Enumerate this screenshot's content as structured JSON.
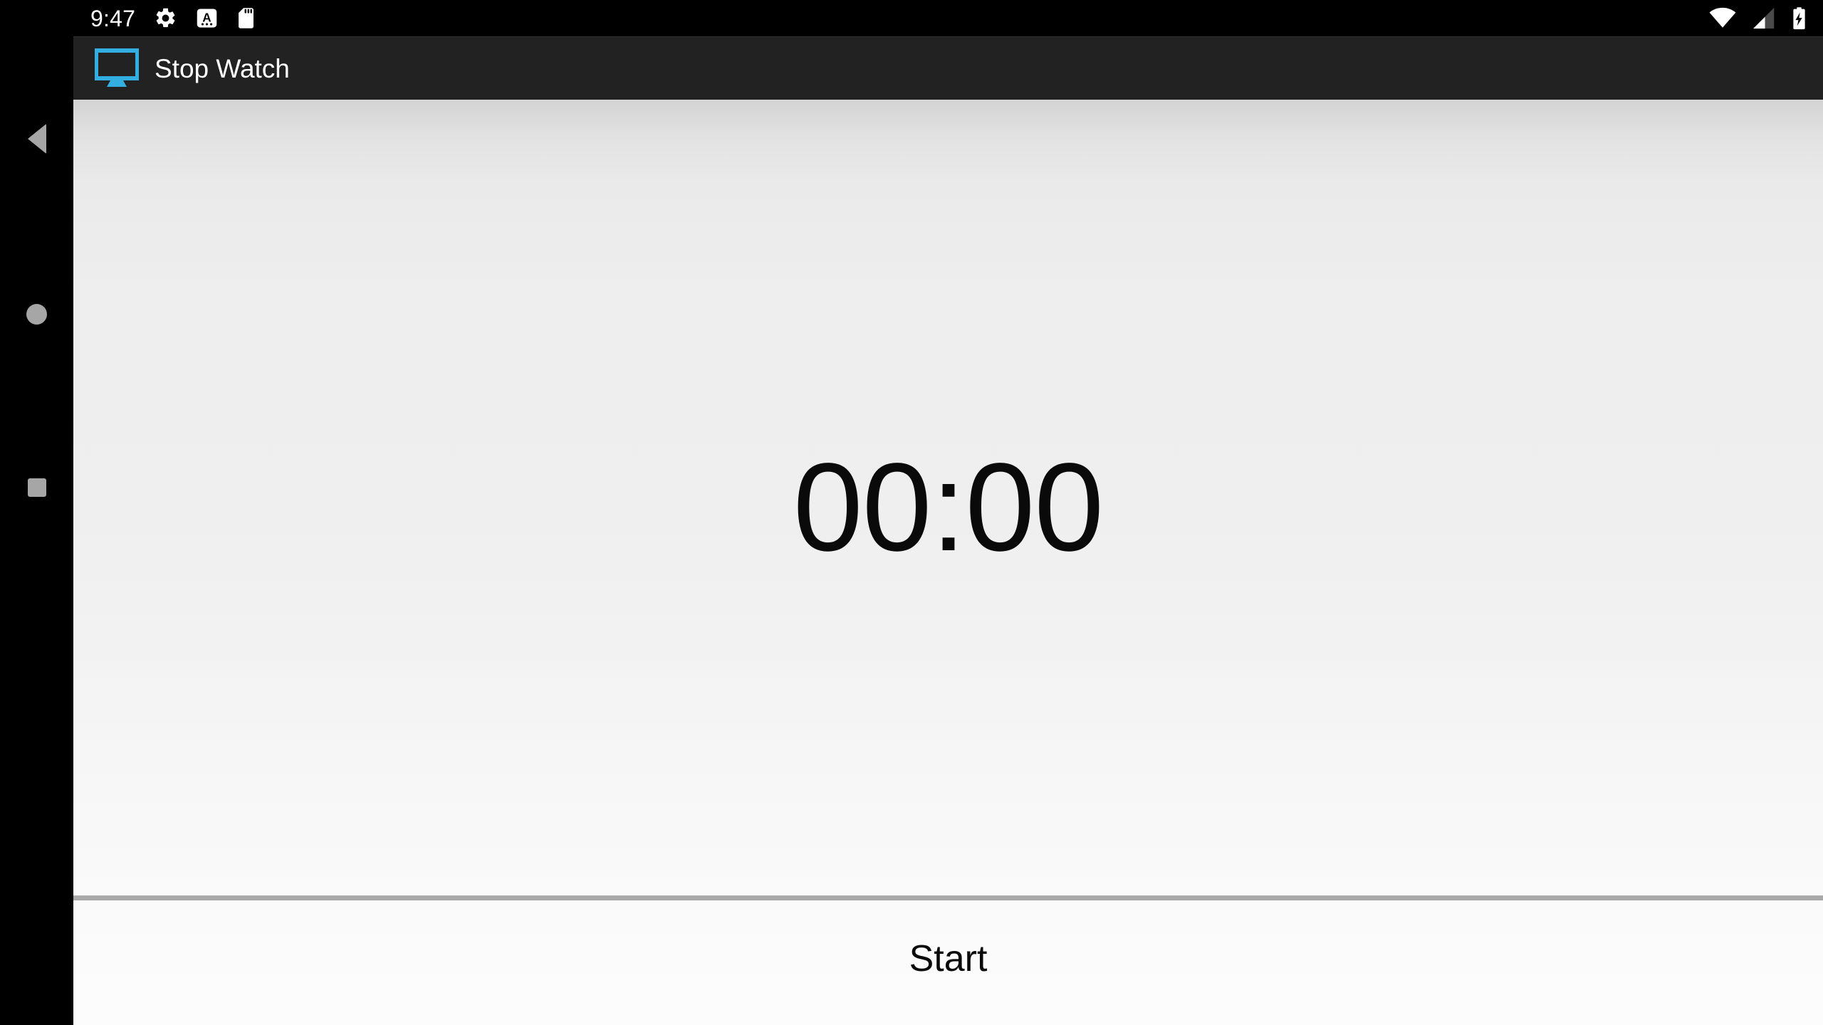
{
  "status_bar": {
    "clock": "9:47",
    "left_icons": [
      {
        "name": "settings-gear-icon",
        "glyph": "gear"
      },
      {
        "name": "keyboard-ime-icon",
        "glyph": "letter-a-box"
      },
      {
        "name": "sd-card-icon",
        "glyph": "sd-card"
      }
    ],
    "right_icons": [
      {
        "name": "wifi-icon",
        "glyph": "wifi-full"
      },
      {
        "name": "cellular-signal-icon",
        "glyph": "signal-partial"
      },
      {
        "name": "battery-charging-icon",
        "glyph": "battery-bolt"
      }
    ],
    "background_color": "#000000",
    "foreground_color": "#ffffff"
  },
  "app_bar": {
    "title": "Stop Watch",
    "icon_name": "monitor-app-icon",
    "icon_color": "#33aee0",
    "background_color": "#222222",
    "title_color": "#ffffff"
  },
  "navigation_bar": {
    "background_color": "#000000",
    "icon_color": "#a6a6a6",
    "buttons": [
      {
        "name": "nav-back-button",
        "label": "Back",
        "shape": "triangle"
      },
      {
        "name": "nav-home-button",
        "label": "Home",
        "shape": "circle"
      },
      {
        "name": "nav-recents-button",
        "label": "Recents",
        "shape": "square"
      }
    ]
  },
  "main": {
    "timer_value": "00:00",
    "timer_color": "#0a0a0a",
    "divider_color": "#a9a9a9",
    "background_top_color": "#d3d3d3",
    "background_bottom_color": "#fcfcfc"
  },
  "action_bar": {
    "start_label": "Start",
    "label_color": "#0a0a0a"
  }
}
